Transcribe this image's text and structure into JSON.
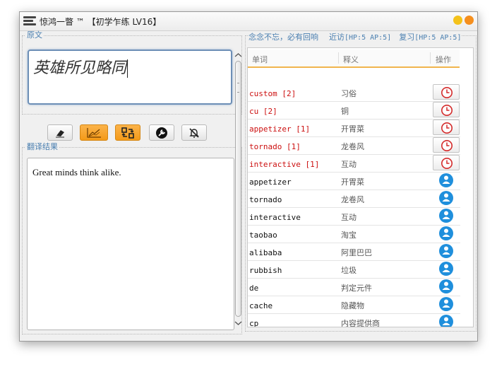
{
  "window": {
    "title": "惊鸿一瞥 ™ 【初学乍练 LV16】",
    "colors": {
      "close": "#f58f1e",
      "minimize": "#f4c21a",
      "accent": "#f49a18",
      "link": "#4a7fb0",
      "new_word": "#cc1010"
    }
  },
  "left": {
    "source_legend": "原文",
    "source_text": "英雄所见略同",
    "result_legend": "翻译结果",
    "result_text": "Great minds think alike.",
    "toolbar": [
      {
        "name": "eraser-button",
        "icon": "eraser-icon",
        "active": false
      },
      {
        "name": "chart-button",
        "icon": "line-chart-icon",
        "active": true
      },
      {
        "name": "convert-button",
        "icon": "swap-icon",
        "active": true
      },
      {
        "name": "tool-button",
        "icon": "wrench-icon",
        "active": false
      },
      {
        "name": "mute-button",
        "icon": "bell-off-icon",
        "active": false
      }
    ]
  },
  "right": {
    "motto": "念念不忘，必有回响",
    "recent_label": "近访",
    "recent_stats": "[HP:5 AP:5]",
    "review_label": "复习",
    "review_stats": "[HP:5 AP:5]",
    "columns": [
      "单词",
      "释义",
      "操作"
    ],
    "rows": [
      {
        "word": "custom [2]",
        "meaning": "习俗",
        "status": "new",
        "action_icon": "clock-icon"
      },
      {
        "word": "cu [2]",
        "meaning": "铜",
        "status": "new",
        "action_icon": "clock-icon"
      },
      {
        "word": "appetizer [1]",
        "meaning": "开胃菜",
        "status": "new",
        "action_icon": "clock-icon"
      },
      {
        "word": "tornado [1]",
        "meaning": "龙卷风",
        "status": "new",
        "action_icon": "clock-icon"
      },
      {
        "word": "interactive [1]",
        "meaning": "互动",
        "status": "new",
        "action_icon": "clock-icon"
      },
      {
        "word": "appetizer",
        "meaning": "开胃菜",
        "status": "known",
        "action_icon": "brain-icon"
      },
      {
        "word": "tornado",
        "meaning": "龙卷风",
        "status": "known",
        "action_icon": "brain-icon"
      },
      {
        "word": "interactive",
        "meaning": "互动",
        "status": "known",
        "action_icon": "brain-icon"
      },
      {
        "word": "taobao",
        "meaning": "淘宝",
        "status": "known",
        "action_icon": "brain-icon"
      },
      {
        "word": "alibaba",
        "meaning": "阿里巴巴",
        "status": "known",
        "action_icon": "brain-icon"
      },
      {
        "word": "rubbish",
        "meaning": "垃圾",
        "status": "known",
        "action_icon": "brain-icon"
      },
      {
        "word": "de",
        "meaning": "判定元件",
        "status": "known",
        "action_icon": "brain-icon"
      },
      {
        "word": "cache",
        "meaning": "隐藏物",
        "status": "known",
        "action_icon": "brain-icon"
      },
      {
        "word": "cp",
        "meaning": "内容提供商",
        "status": "known",
        "action_icon": "brain-icon"
      },
      {
        "word": "",
        "meaning": "",
        "status": "known",
        "action_icon": "brain-icon"
      }
    ]
  }
}
